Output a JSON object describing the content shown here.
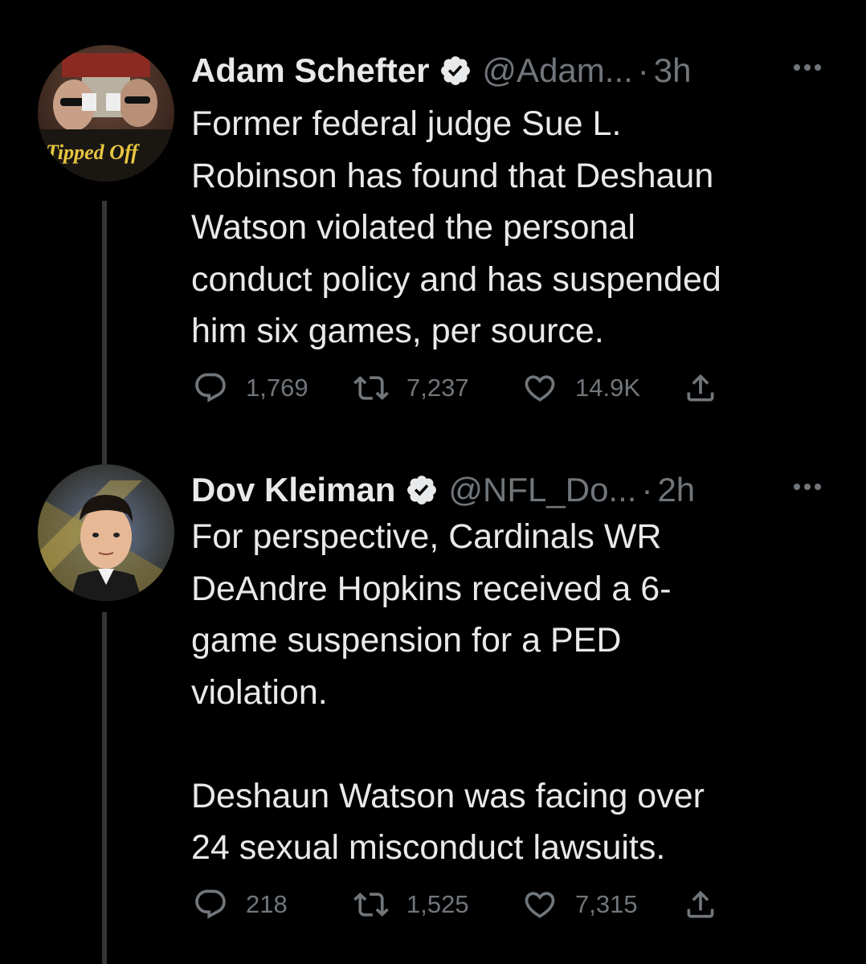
{
  "tweets": [
    {
      "name": "Adam Schefter",
      "handle": "@Adam...",
      "separator": "·",
      "time": "3h",
      "text": "Former federal judge Sue L.\nRobinson has found that Deshaun\nWatson violated the personal\nconduct policy and has suspended\nhim six games, per source.",
      "replies": "1,769",
      "retweets": "7,237",
      "likes": "14.9K",
      "avatar_caption": "Tipped Off"
    },
    {
      "name": "Dov Kleiman",
      "handle": "@NFL_Do...",
      "separator": "·",
      "time": "2h",
      "text": "For perspective, Cardinals WR\nDeAndre Hopkins received a 6-\ngame suspension for a PED\nviolation.\n\nDeshaun Watson was facing over\n24 sexual misconduct lawsuits.",
      "replies": "218",
      "retweets": "1,525",
      "likes": "7,315"
    }
  ],
  "colors": {
    "background": "#000000",
    "text_primary": "#e7e9ea",
    "text_secondary": "#71767b",
    "thread_line": "#333639"
  },
  "icons": {
    "verified": "verified-badge-icon",
    "more": "more-options-icon",
    "reply": "reply-icon",
    "retweet": "retweet-icon",
    "like": "heart-icon",
    "share": "share-icon"
  }
}
